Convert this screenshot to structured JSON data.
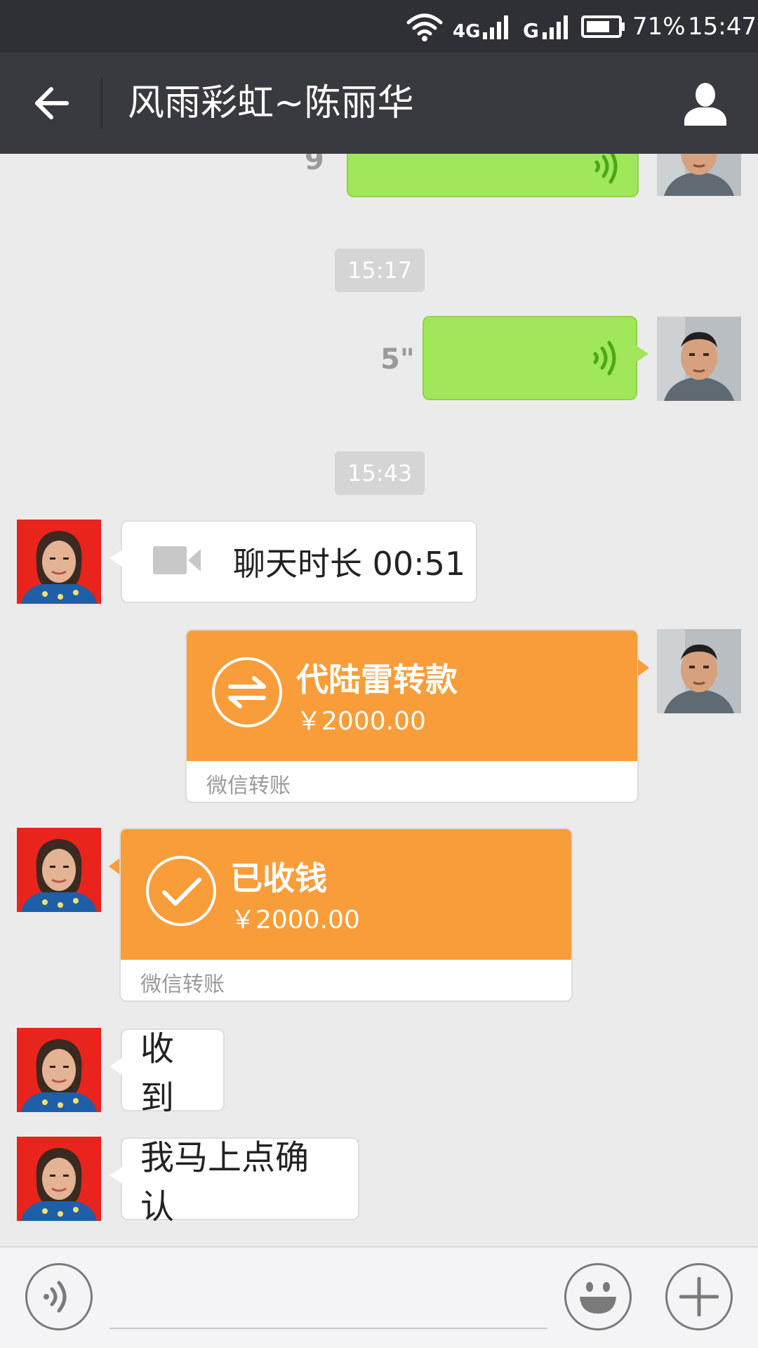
{
  "status_bar": {
    "network_4g": "4G",
    "network_g": "G",
    "battery_percent": "71%",
    "time": "15:47",
    "icons": [
      "wifi-icon",
      "signal-icon",
      "battery-icon"
    ]
  },
  "header": {
    "title": "风雨彩虹~陈丽华",
    "icons": [
      "back-arrow-icon",
      "contact-profile-icon"
    ]
  },
  "messages": {
    "voice_partial_duration": "9",
    "time_1": "15:17",
    "voice_duration": "5\"",
    "time_2": "15:43",
    "video_call_text": "聊天时长 00:51",
    "transfer_sent": {
      "title": "代陆雷转款",
      "amount": "￥2000.00",
      "footer": "微信转账"
    },
    "transfer_received": {
      "title": "已收钱",
      "amount": "￥2000.00",
      "footer": "微信转账"
    },
    "text_1": "收到",
    "text_2": "我马上点确认"
  },
  "input_bar": {
    "value": "",
    "icons": [
      "voice-mode-icon",
      "emoji-icon",
      "plus-icon"
    ]
  },
  "colors": {
    "status_bar": "#2e3035",
    "title_bar": "#393a3f",
    "chat_background": "#ebebeb",
    "sent_bubble": "#a0e759",
    "transfer_card": "#f89d3a",
    "voice_wave": "#4aa81a"
  }
}
